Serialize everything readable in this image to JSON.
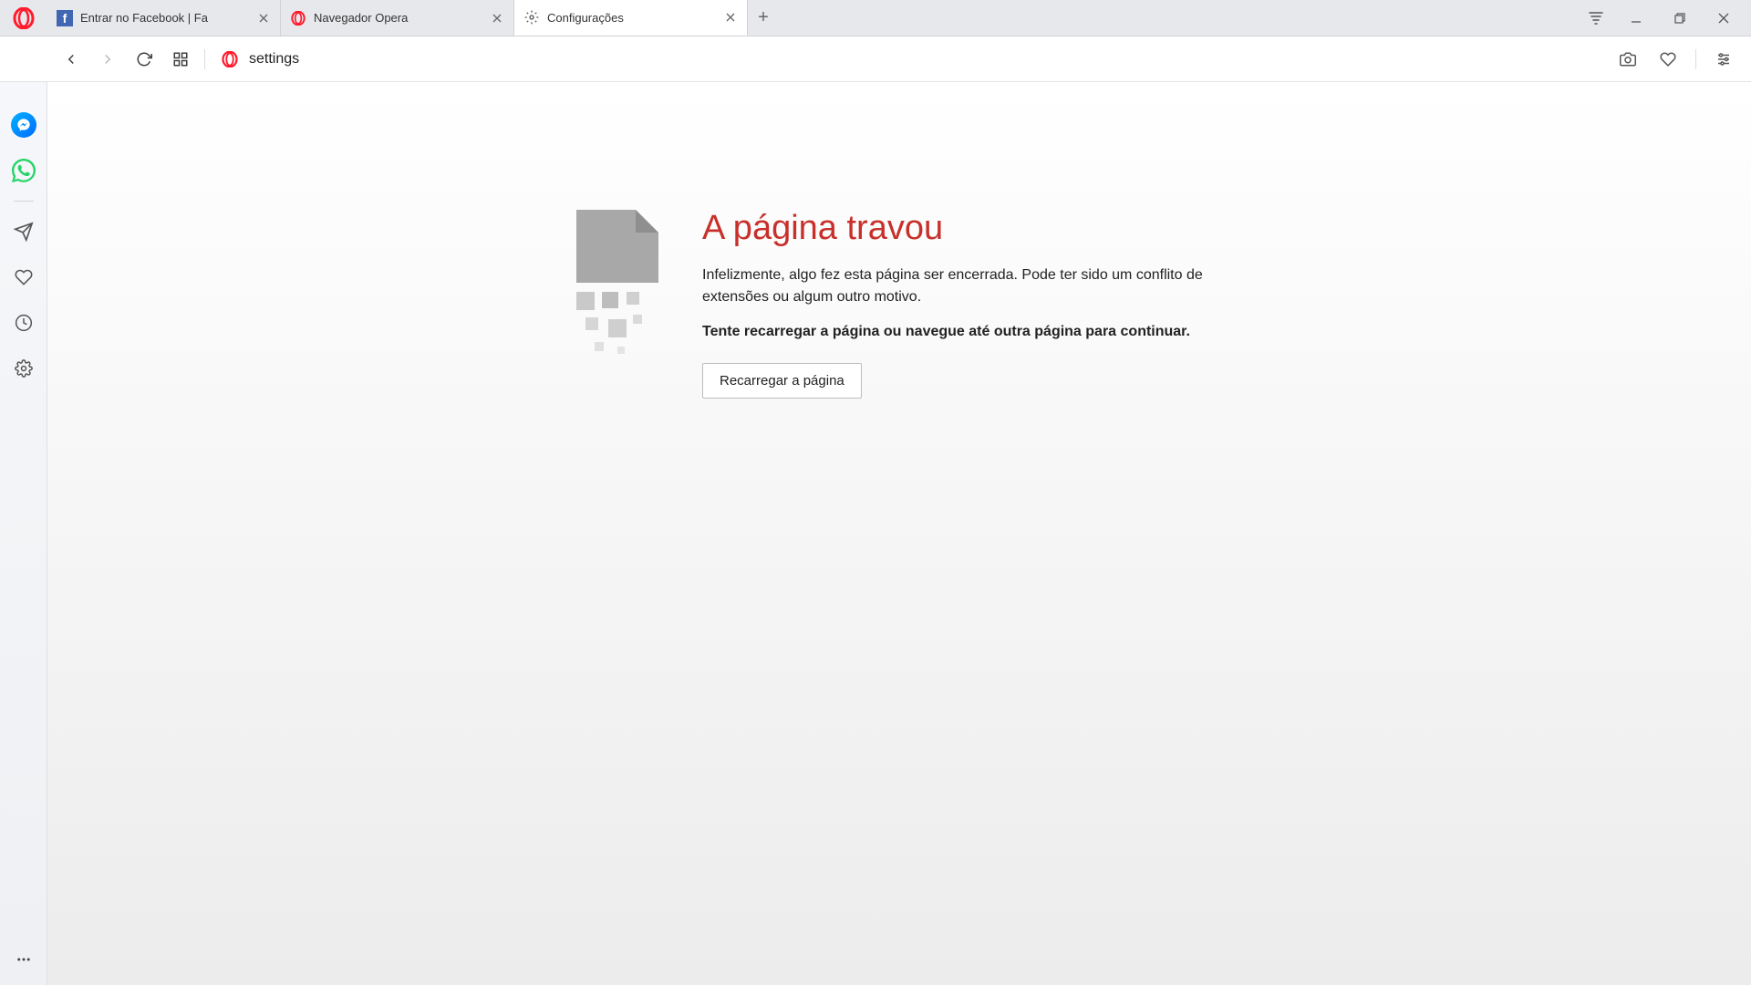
{
  "tabs": [
    {
      "title": "Entrar no Facebook | Fa",
      "icon": "facebook"
    },
    {
      "title": "Navegador Opera",
      "icon": "opera"
    },
    {
      "title": "Configurações",
      "icon": "gear"
    }
  ],
  "active_tab_index": 2,
  "address_bar": {
    "value": "settings"
  },
  "error": {
    "title": "A página travou",
    "description": "Infelizmente, algo fez esta página ser encerrada. Pode ter sido um conflito de extensões ou algum outro motivo.",
    "instruction": "Tente recarregar a página ou navegue até outra página para continuar.",
    "reload_button_label": "Recarregar a página"
  },
  "sidebar": {
    "icons": [
      "messenger",
      "whatsapp",
      "send",
      "heart",
      "history",
      "settings"
    ]
  }
}
